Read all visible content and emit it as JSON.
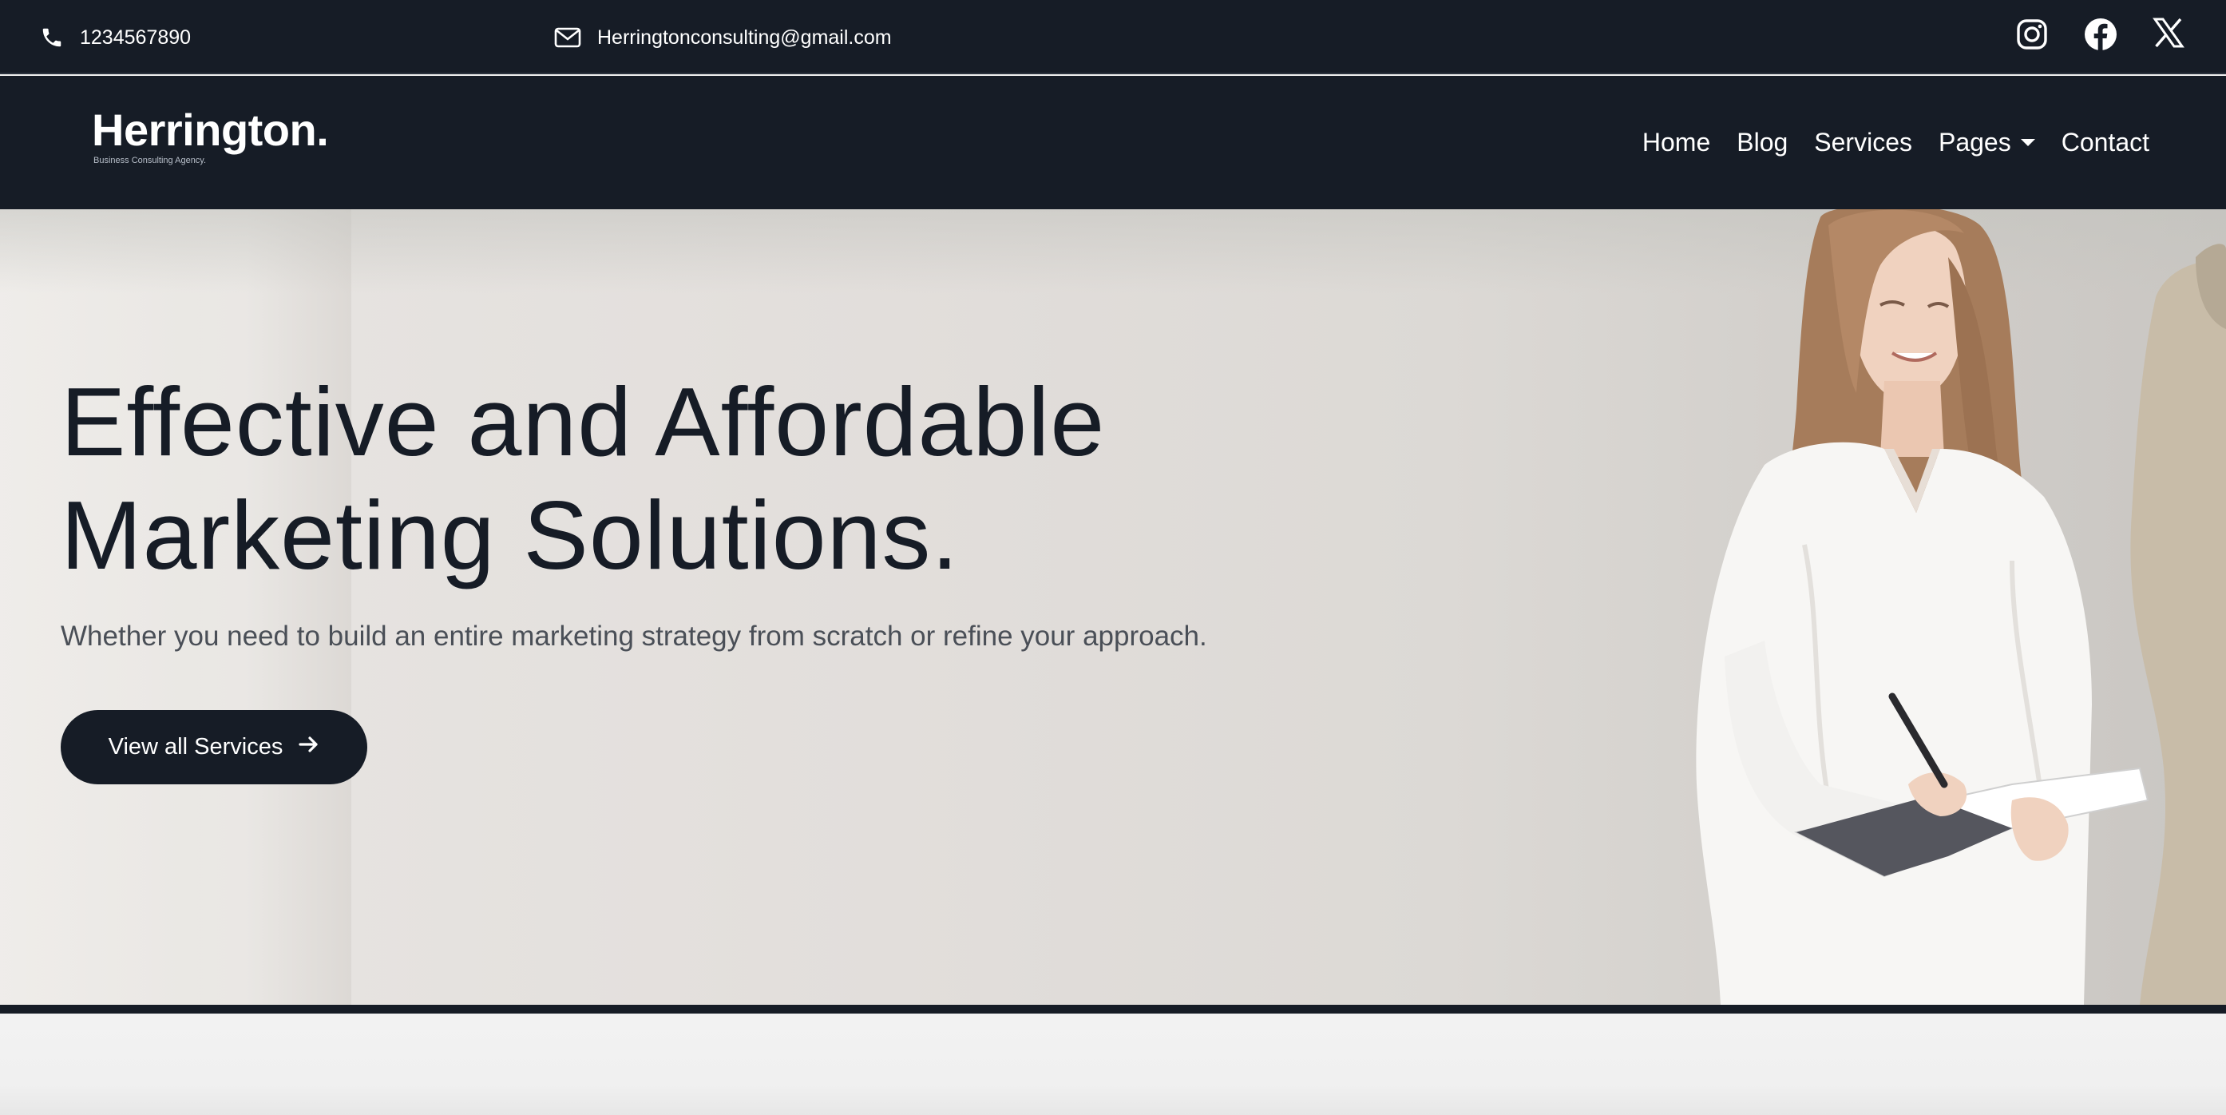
{
  "topbar": {
    "phone": "1234567890",
    "email": "Herringtonconsulting@gmail.com",
    "socials": [
      "instagram-icon",
      "facebook-icon",
      "x-icon"
    ]
  },
  "header": {
    "logo_name": "Herrington.",
    "logo_tagline": "Business Consulting Agency.",
    "nav": [
      {
        "label": "Home"
      },
      {
        "label": "Blog"
      },
      {
        "label": "Services"
      },
      {
        "label": "Pages",
        "has_dropdown": true
      },
      {
        "label": "Contact"
      }
    ]
  },
  "hero": {
    "title_line1": "Effective and Affordable",
    "title_line2": "Marketing Solutions.",
    "subtitle": "Whether you need to build an entire marketing strategy from scratch or refine your approach.",
    "cta_label": "View all Services",
    "cta_icon": "arrow-right-icon"
  },
  "colors": {
    "dark": "#161c26",
    "text_muted": "#4a4f57",
    "hero_bg": "#e3dfdb"
  }
}
